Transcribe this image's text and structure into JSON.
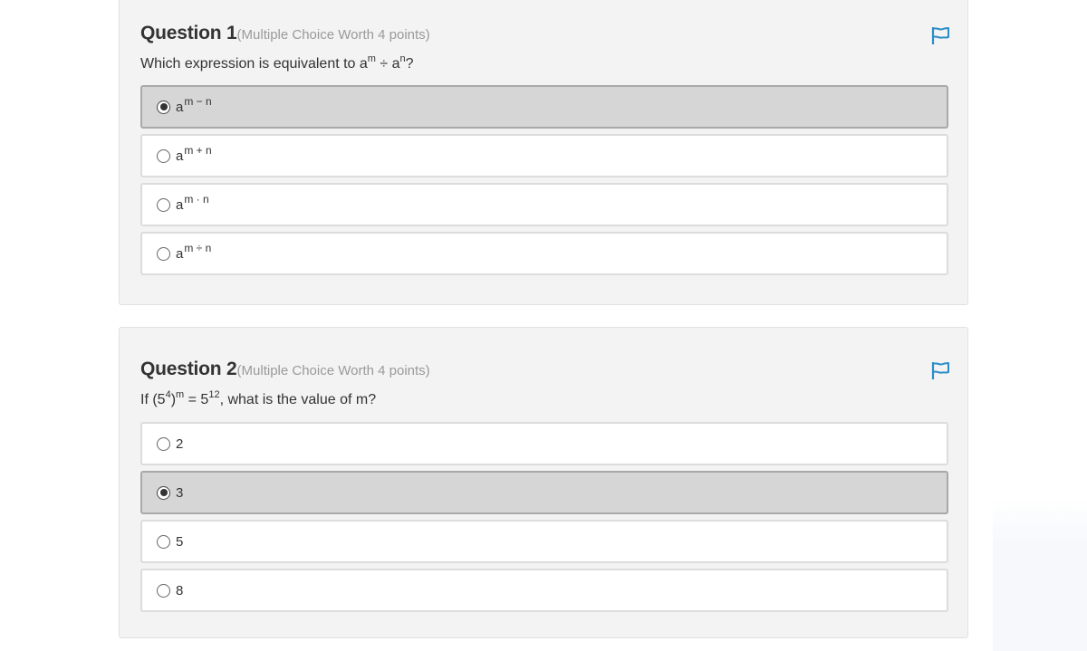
{
  "questions": [
    {
      "title": "Question 1",
      "meta": "(Multiple Choice Worth 4 points)",
      "prompt": {
        "prefix": "Which expression is equivalent to a",
        "sup1": "m",
        "middle": " ÷ a",
        "sup2": "n",
        "suffix": "?"
      },
      "options": [
        {
          "base": "a",
          "exponent": "m − n",
          "selected": true
        },
        {
          "base": "a",
          "exponent": "m + n",
          "selected": false
        },
        {
          "base": "a",
          "exponent": "m · n",
          "selected": false
        },
        {
          "base": "a",
          "exponent": "m ÷ n",
          "selected": false
        }
      ]
    },
    {
      "title": "Question 2",
      "meta": "(Multiple Choice Worth 4 points)",
      "prompt": {
        "p1": "If (5",
        "sup1": "4",
        "p2": ")",
        "sup2": "m",
        "p3": " = 5",
        "sup3": "12",
        "p4": ", what is the value of m?"
      },
      "options": [
        {
          "label": "2",
          "selected": false
        },
        {
          "label": "3",
          "selected": true
        },
        {
          "label": "5",
          "selected": false
        },
        {
          "label": "8",
          "selected": false
        }
      ]
    }
  ],
  "icons": {
    "flag": "flag-icon"
  },
  "colors": {
    "flag": "#2a8dc8",
    "card_bg": "#f3f3f3",
    "selected_bg": "#d6d6d6"
  }
}
